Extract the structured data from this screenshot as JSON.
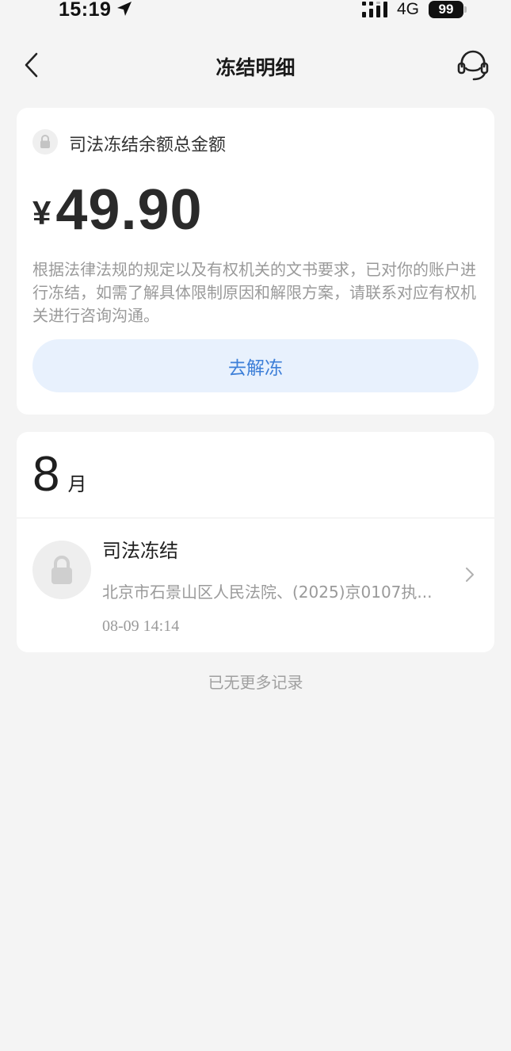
{
  "status_bar": {
    "time": "15:19",
    "location_icon": "location-arrow-icon",
    "signal_icon": "signal-icon",
    "network": "4G",
    "battery": "99"
  },
  "nav": {
    "back_icon": "chevron-left-icon",
    "title": "冻结明细",
    "service_icon": "customer-service-icon"
  },
  "balance_card": {
    "lock_icon": "lock-icon",
    "label": "司法冻结余额总金额",
    "currency": "¥",
    "amount": "49.90",
    "description": "根据法律法规的规定以及有权机关的文书要求，已对你的账户进行冻结，如需了解具体限制原因和解限方案，请联系对应有权机关进行咨询沟通。",
    "button_label": "去解冻",
    "accent_color": "#3d7fd8",
    "button_bg": "#e8f1fd"
  },
  "records": {
    "month_number": "8",
    "month_unit": "月",
    "items": [
      {
        "icon": "lock-icon",
        "title": "司法冻结",
        "subtitle": "北京市石景山区人民法院、(2025)京0107执...",
        "time": "08-09 14:14",
        "chevron_icon": "chevron-right-icon"
      }
    ]
  },
  "footer": {
    "no_more": "已无更多记录"
  }
}
